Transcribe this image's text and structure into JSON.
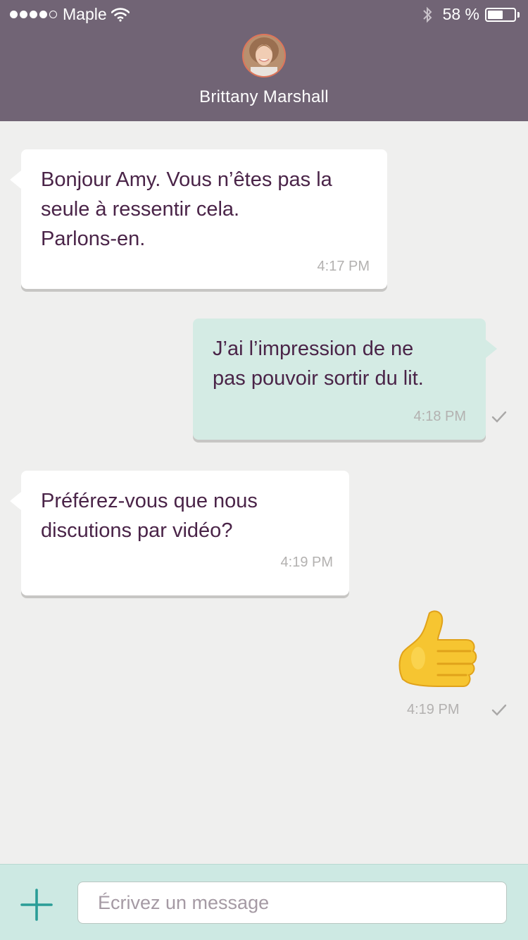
{
  "status_bar": {
    "carrier": "Maple",
    "signal_bars_filled": 4,
    "signal_bars_total": 5,
    "battery_percent": "58 %",
    "battery_level": 0.58,
    "wifi_icon": "wifi-icon",
    "bluetooth_icon": "bluetooth-icon"
  },
  "header": {
    "contact_name": "Brittany Marshall",
    "header_color": "#716475"
  },
  "messages": [
    {
      "direction": "incoming",
      "text": "Bonjour Amy. Vous n’êtes pas la\nseule à ressentir cela.\nParlons-en.",
      "time": "4:17 PM"
    },
    {
      "direction": "outgoing",
      "text": "J’ai l’impression de ne\npas pouvoir sortir du lit.",
      "time": "4:18 PM",
      "status_icon": "checkmark-icon"
    },
    {
      "direction": "incoming",
      "text": "Préférez-vous que nous\ndiscutions par vidéo?",
      "time": "4:19 PM"
    },
    {
      "direction": "outgoing",
      "emoji": "thumbs-up-icon",
      "time": "4:19 PM",
      "status_icon": "checkmark-icon"
    }
  ],
  "composer": {
    "add_icon": "plus-icon",
    "placeholder": "Écrivez un message",
    "value": ""
  },
  "colors": {
    "accent": "#2a9d97",
    "incoming_bubble": "#ffffff",
    "outgoing_bubble": "#d4ebe4",
    "text": "#4a2448",
    "background": "#efefee"
  }
}
